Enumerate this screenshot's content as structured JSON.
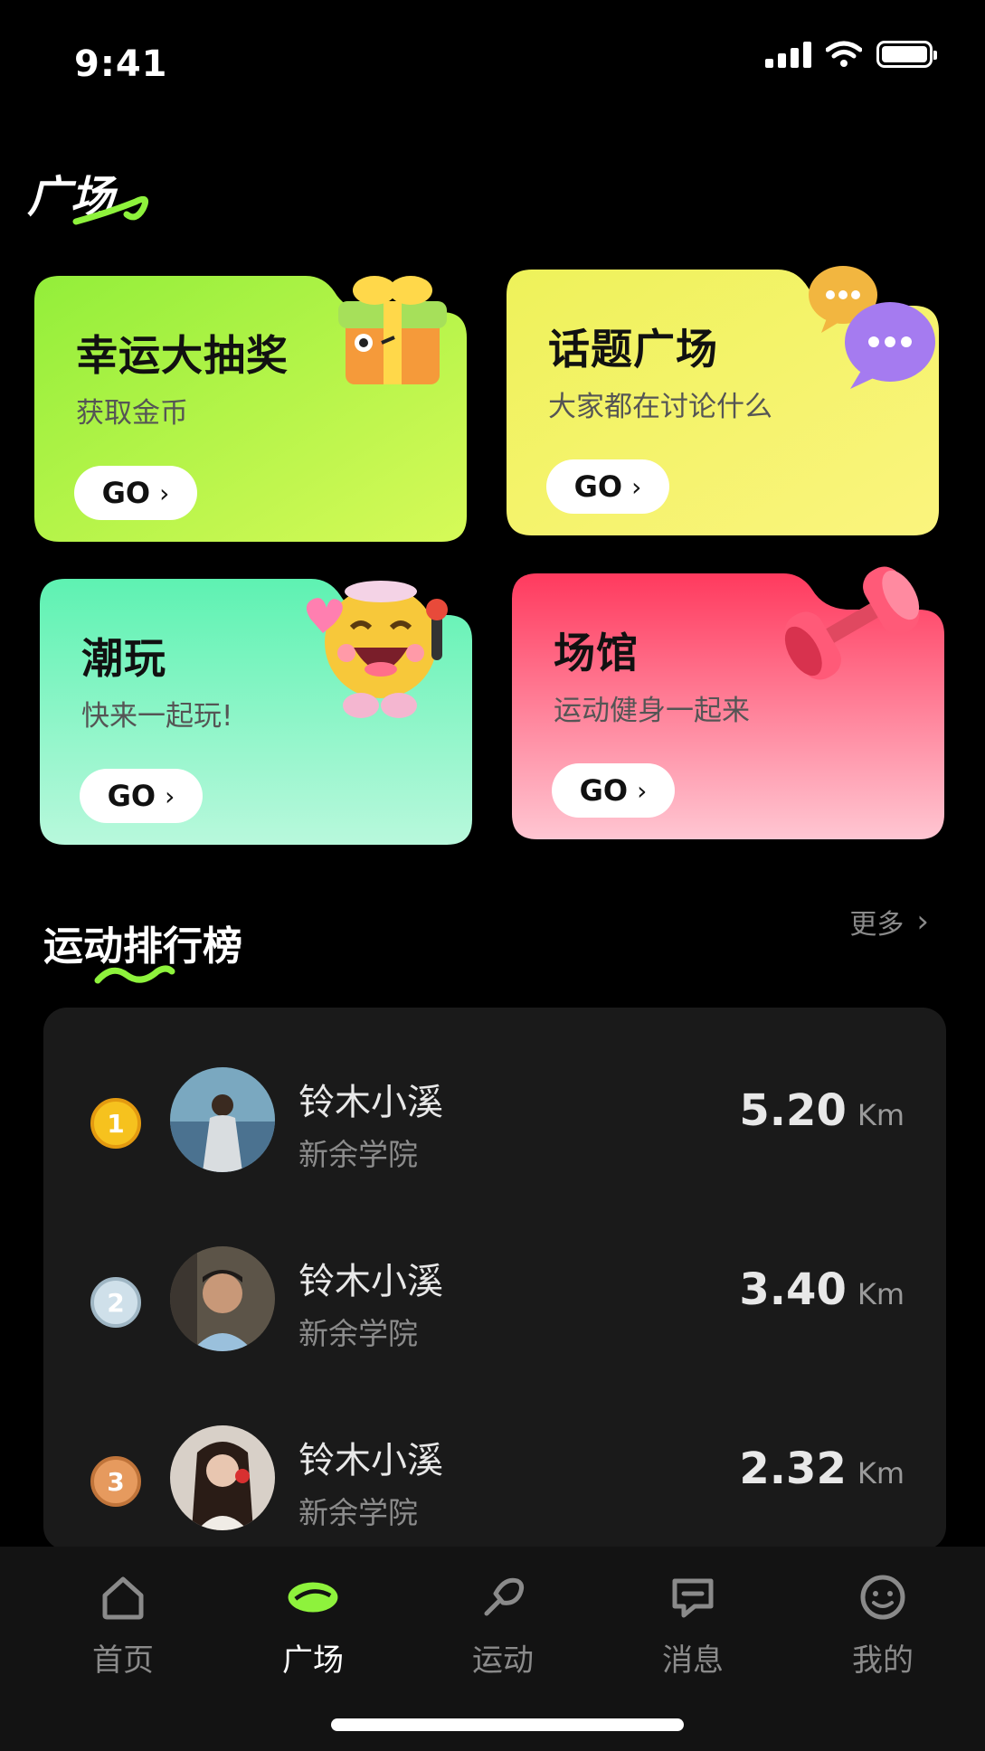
{
  "status_bar": {
    "time": "9:41"
  },
  "page_title": "广场",
  "cards": [
    {
      "title": "幸运大抽奖",
      "subtitle": "获取金币",
      "go": "GO",
      "art": "gift-box"
    },
    {
      "title": "话题广场",
      "subtitle": "大家都在讨论什么",
      "go": "GO",
      "art": "chat-bubbles"
    },
    {
      "title": "潮玩",
      "subtitle": "快来一起玩!",
      "go": "GO",
      "art": "emoji-character"
    },
    {
      "title": "场馆",
      "subtitle": "运动健身一起来",
      "go": "GO",
      "art": "dumbbell"
    }
  ],
  "ranking": {
    "title": "运动排行榜",
    "more": "更多",
    "rows": [
      {
        "rank": "1",
        "name": "铃木小溪",
        "school": "新余学院",
        "distance": "5.20",
        "unit": "Km"
      },
      {
        "rank": "2",
        "name": "铃木小溪",
        "school": "新余学院",
        "distance": "3.40",
        "unit": "Km"
      },
      {
        "rank": "3",
        "name": "铃木小溪",
        "school": "新余学院",
        "distance": "2.32",
        "unit": "Km"
      }
    ]
  },
  "tabs": [
    {
      "label": "首页",
      "icon": "home-icon"
    },
    {
      "label": "广场",
      "icon": "plaza-icon",
      "active": true
    },
    {
      "label": "运动",
      "icon": "sport-icon"
    },
    {
      "label": "消息",
      "icon": "message-icon"
    },
    {
      "label": "我的",
      "icon": "profile-icon"
    }
  ],
  "colors": {
    "accent": "#8ef23c",
    "card1": "#b6f53c",
    "card2": "#f4f16a",
    "card3": "#8ff5c8",
    "card4": "#ff5a78",
    "panel": "#1a1a1a",
    "tabbar": "#131313"
  }
}
